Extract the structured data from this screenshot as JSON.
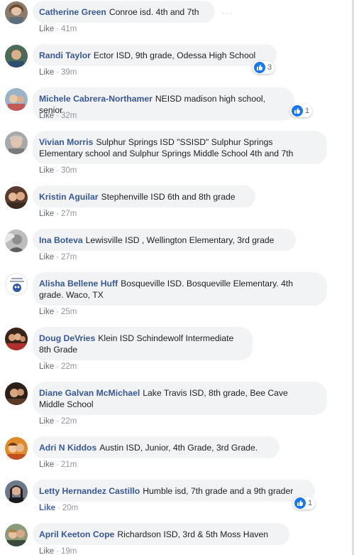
{
  "comments": [
    {
      "author": "Catherine Green",
      "text": "Conroe isd. 4th and 7th",
      "like": "Like",
      "time": "41m",
      "reactions": ""
    },
    {
      "author": "Randi Taylor",
      "text": "Ector ISD, 9th grade, Odessa High School",
      "like": "Like",
      "time": "39m",
      "reactions": "3"
    },
    {
      "author": "Michele Cabrera-Northamer",
      "text": "NEISD madison high school, senior",
      "like": "Like",
      "time": "32m",
      "reactions": "1"
    },
    {
      "author": "Vivian Morris",
      "text": "Sulphur Springs ISD \"SSISD\" Sulphur Springs",
      "text2": "Elementary school and Sulphur Springs Middle School 4th and 7th",
      "like": "Like",
      "time": "30m",
      "reactions": ""
    },
    {
      "author": "Kristin Aguilar",
      "text": "Stephenville ISD 6th and 8th grade",
      "like": "Like",
      "time": "27m",
      "reactions": ""
    },
    {
      "author": "Ina Boteva",
      "text": "Lewisville ISD , Wellington Elementary, 3rd grade",
      "like": "Like",
      "time": "27m",
      "reactions": ""
    },
    {
      "author": "Alisha Bellene Huff",
      "text": "Bosqueville ISD. Bosqueville Elementary. 4th",
      "text2": "grade. Waco, TX",
      "like": "Like",
      "time": "25m",
      "reactions": ""
    },
    {
      "author": "Doug DeVries",
      "text": "Klein ISD Schindewolf Intermediate",
      "text2": "8th Grade",
      "like": "Like",
      "time": "22m",
      "reactions": ""
    },
    {
      "author": "Diane Galvan McMichael",
      "text": "Lake Travis ISD, 8th grade, Bee Cave",
      "text2": "Middle School",
      "like": "Like",
      "time": "22m",
      "reactions": ""
    },
    {
      "author": "Adri N Kiddos",
      "text": "Austin ISD, Junior, 4th Grade, 3rd Grade.",
      "like": "Like",
      "time": "21m",
      "reactions": ""
    },
    {
      "author": "Letty Hernandez Castillo",
      "text": "Humble isd, 7th grade and a 9th grader",
      "like": "Like",
      "time": "20m",
      "reactions": "1"
    },
    {
      "author": "April Keeton Cope",
      "text": "Richardson ISD, 3rd & 5th Moss Haven",
      "like": "Like",
      "time": "19m",
      "reactions": ""
    }
  ],
  "separator": "·",
  "more_options": "···",
  "colors": {
    "author": "#385898",
    "bubble": "#f2f3f5",
    "meta": "#90949c",
    "like_blue": "#1877f2"
  }
}
